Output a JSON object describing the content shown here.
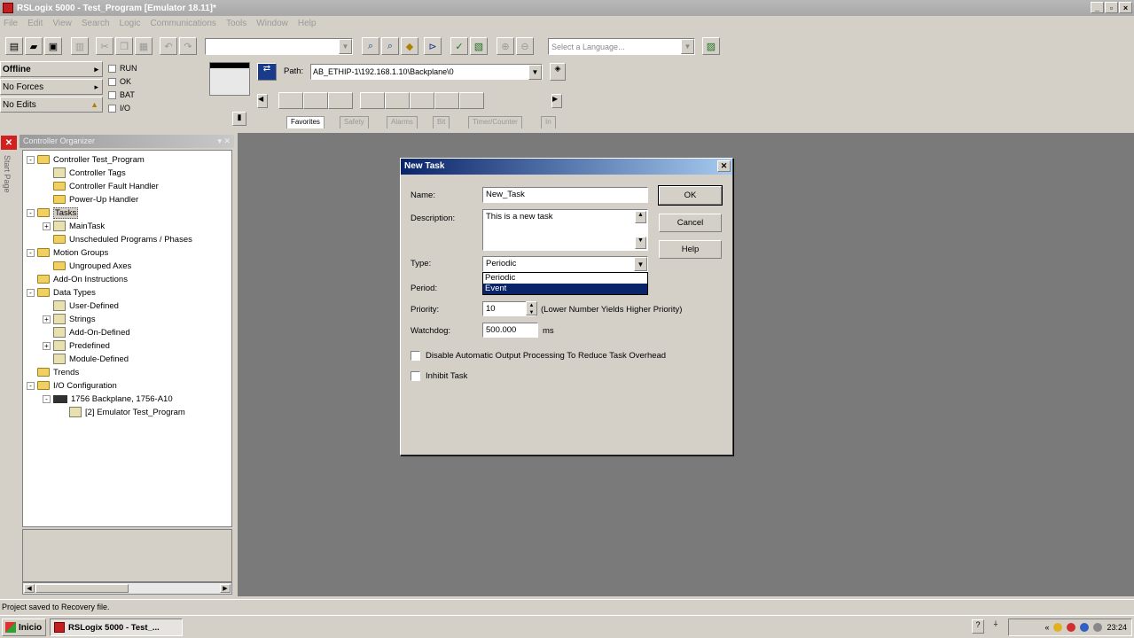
{
  "window": {
    "title": "RSLogix 5000 - Test_Program [Emulator 18.11]*",
    "min": "_",
    "restore": "▫",
    "close": "×"
  },
  "menu": [
    "File",
    "Edit",
    "View",
    "Search",
    "Logic",
    "Communications",
    "Tools",
    "Window",
    "Help"
  ],
  "toolbar": {
    "language_placeholder": "Select a Language..."
  },
  "controller_status": {
    "mode": "Offline",
    "forces": "No Forces",
    "edits": "No Edits",
    "indicators": [
      "RUN",
      "OK",
      "BAT",
      "I/O"
    ]
  },
  "path": {
    "label": "Path:",
    "value": "AB_ETHIP-1\\192.168.1.10\\Backplane\\0"
  },
  "instruction_tabs": [
    "Favorites",
    "Safety",
    "Alarms",
    "Bit",
    "Timer/Counter",
    "In"
  ],
  "organizer": {
    "title": "Controller Organizer",
    "side_label": "Start Page",
    "tree": [
      {
        "label": "Controller Test_Program",
        "level": 0,
        "icon": "folder",
        "expander": "-"
      },
      {
        "label": "Controller Tags",
        "level": 1,
        "icon": "doc",
        "expander": ""
      },
      {
        "label": "Controller Fault Handler",
        "level": 1,
        "icon": "folder",
        "expander": ""
      },
      {
        "label": "Power-Up Handler",
        "level": 1,
        "icon": "folder",
        "expander": ""
      },
      {
        "label": "Tasks",
        "level": 0,
        "icon": "folder",
        "expander": "-",
        "selected": true
      },
      {
        "label": "MainTask",
        "level": 1,
        "icon": "doc",
        "expander": "+"
      },
      {
        "label": "Unscheduled Programs / Phases",
        "level": 1,
        "icon": "folder",
        "expander": ""
      },
      {
        "label": "Motion Groups",
        "level": 0,
        "icon": "folder",
        "expander": "-"
      },
      {
        "label": "Ungrouped Axes",
        "level": 1,
        "icon": "folder",
        "expander": ""
      },
      {
        "label": "Add-On Instructions",
        "level": 0,
        "icon": "folder",
        "expander": ""
      },
      {
        "label": "Data Types",
        "level": 0,
        "icon": "folder",
        "expander": "-"
      },
      {
        "label": "User-Defined",
        "level": 1,
        "icon": "doc",
        "expander": ""
      },
      {
        "label": "Strings",
        "level": 1,
        "icon": "doc",
        "expander": "+"
      },
      {
        "label": "Add-On-Defined",
        "level": 1,
        "icon": "doc",
        "expander": ""
      },
      {
        "label": "Predefined",
        "level": 1,
        "icon": "doc",
        "expander": "+"
      },
      {
        "label": "Module-Defined",
        "level": 1,
        "icon": "doc",
        "expander": ""
      },
      {
        "label": "Trends",
        "level": 0,
        "icon": "folder",
        "expander": ""
      },
      {
        "label": "I/O Configuration",
        "level": 0,
        "icon": "folder",
        "expander": "-"
      },
      {
        "label": "1756 Backplane, 1756-A10",
        "level": 1,
        "icon": "chip",
        "expander": "-"
      },
      {
        "label": "[2] Emulator Test_Program",
        "level": 2,
        "icon": "doc",
        "expander": ""
      }
    ]
  },
  "dialog": {
    "title": "New Task",
    "name_label": "Name:",
    "name_value": "New_Task",
    "description_label": "Description:",
    "description_value": "This is a new task",
    "type_label": "Type:",
    "type_value": "Periodic",
    "type_options": [
      "Periodic",
      "Event"
    ],
    "type_highlighted": "Event",
    "period_label": "Period:",
    "priority_label": "Priority:",
    "priority_value": "10",
    "priority_hint": "(Lower Number Yields Higher Priority)",
    "watchdog_label": "Watchdog:",
    "watchdog_value": "500.000",
    "watchdog_unit": "ms",
    "disable_output_label": "Disable Automatic Output Processing To Reduce Task Overhead",
    "inhibit_label": "Inhibit Task",
    "ok_label": "OK",
    "cancel_label": "Cancel",
    "help_label": "Help"
  },
  "statusbar": {
    "text": "Project saved to Recovery file."
  },
  "taskbar": {
    "start_label": "Inicio",
    "task_label": "RSLogix 5000 - Test_...",
    "clock": "23:24"
  }
}
